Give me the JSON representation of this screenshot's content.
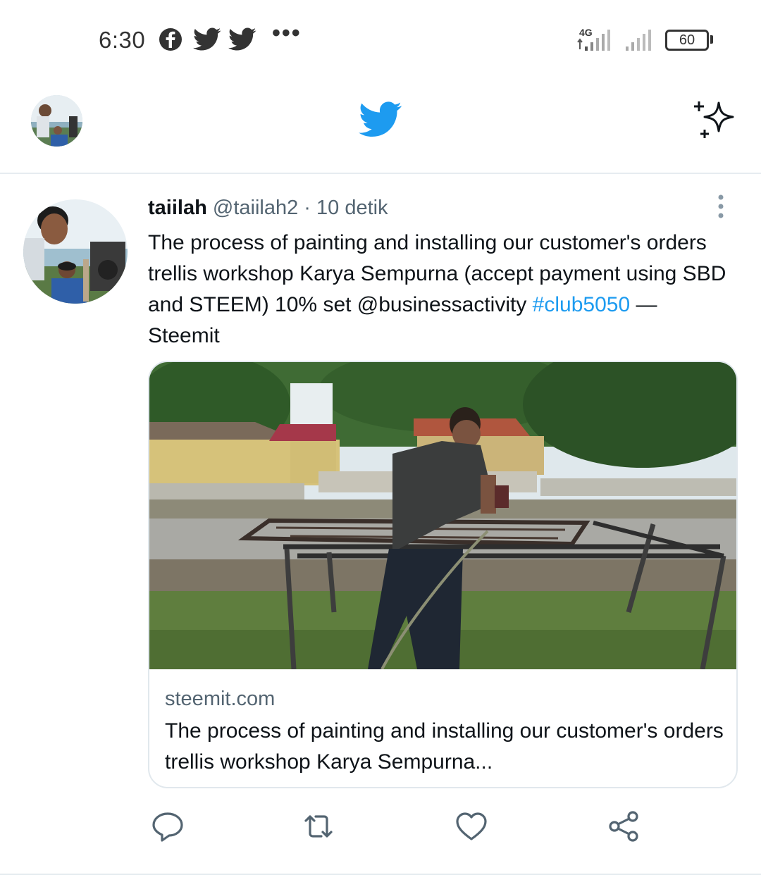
{
  "status_bar": {
    "time": "6:30",
    "app_icons": [
      "facebook-icon",
      "twitter-icon",
      "twitter-icon"
    ],
    "overflow": "•••",
    "network": "4G",
    "battery": "60"
  },
  "top_bar": {
    "logo_color": "#1d9bf0",
    "logo": "twitter-bird-icon",
    "right_icon": "sparkle-icon"
  },
  "tweet": {
    "name": "taiilah",
    "handle": "@taiilah2",
    "separator": "·",
    "time": "10 detik",
    "text_main": "The process of painting and installing our customer's orders trellis workshop Karya Sempurna (accept payment using SBD and STEEM) 10% set @businessactivity ",
    "hashtag": "#club5050",
    "text_tail": " — Steemit",
    "card": {
      "domain": "steemit.com",
      "title": "The process of painting and installing our customer's orders trellis workshop Karya Sempurna..."
    },
    "actions": [
      "reply-icon",
      "retweet-icon",
      "like-icon",
      "share-icon"
    ]
  },
  "colors": {
    "accent": "#1d9bf0",
    "secondary_text": "#536471",
    "divider": "#e6ecf0"
  }
}
